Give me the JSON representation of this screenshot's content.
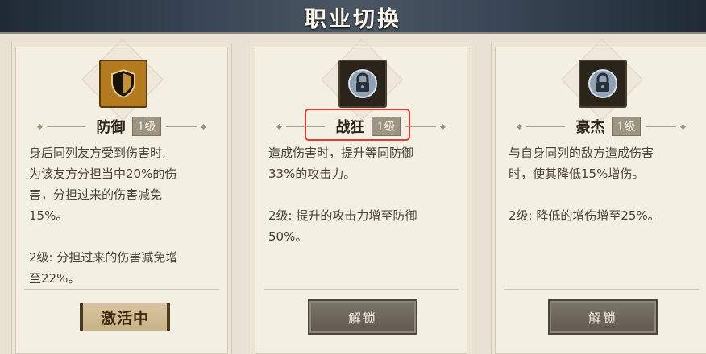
{
  "header": {
    "title": "职业切换"
  },
  "cards": [
    {
      "name": "防御",
      "level": "1级",
      "icon": "shield-icon",
      "locked": false,
      "desc_lines": [
        "身后同列友方受到伤害时,",
        "为该友方分担当中20%的伤",
        "害，分担过来的伤害减免",
        "15%。"
      ],
      "upgrade_lines": [
        "2级: 分担过来的伤害减免增",
        "至22%。"
      ],
      "status_label": "激活中"
    },
    {
      "name": "战狂",
      "level": "1级",
      "icon": "lock-icon",
      "locked": true,
      "desc_lines": [
        "造成伤害时，提升等同防御",
        "33%的攻击力。"
      ],
      "upgrade_lines": [
        "2级: 提升的攻击力增至防御",
        "50%。"
      ],
      "button_label": "解锁"
    },
    {
      "name": "豪杰",
      "level": "1级",
      "icon": "lock-icon",
      "locked": true,
      "desc_lines": [
        "与自身同列的敌方造成伤害",
        "时，使其降低15%增伤。"
      ],
      "upgrade_lines": [
        "2级: 降低的增伤增至25%。"
      ],
      "button_label": "解锁"
    }
  ],
  "colors": {
    "highlight": "#e53b2f",
    "gold": "#b37a1f",
    "title_bar": "#3a4756"
  }
}
